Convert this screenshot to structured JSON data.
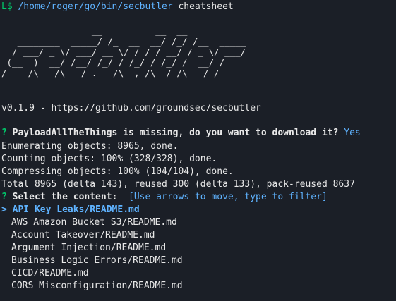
{
  "prompt": {
    "bracket": "L$",
    "path": "/home/roger/go/bin/secbutler",
    "command": "cheatsheet"
  },
  "banner": {
    "art": "                 __          __  __\n   ________  _____/ /_  __  __/ /_/ /__  _____\n  / ___/ _ \\/ ___/ __ \\/ / / / __/ / _ \\/ ___/\n (__  )  __/ /__/ /_/ / /_/ / /_/ /  __/ /\n/____/\\___/\\___/_.___/\\__,_/\\__/_/\\___/_/"
  },
  "version_line": "v0.1.9 - https://github.com/groundsec/secbutler",
  "question": {
    "mark": "?",
    "text": "PayloadAllTheThings is missing, do you want to download it?",
    "answer": "Yes"
  },
  "git_output": [
    "Enumerating objects: 8965, done.",
    "Counting objects: 100% (328/328), done.",
    "Compressing objects: 100% (104/104), done.",
    "Total 8965 (delta 143), reused 300 (delta 133), pack-reused 8637"
  ],
  "select": {
    "mark": "?",
    "label": "Select the content:",
    "hint": "[Use arrows to move, type to filter]",
    "cursor": ">",
    "options": [
      "API Key Leaks/README.md",
      "AWS Amazon Bucket S3/README.md",
      "Account Takeover/README.md",
      "Argument Injection/README.md",
      "Business Logic Errors/README.md",
      "CICD/README.md",
      "CORS Misconfiguration/README.md"
    ],
    "selected_index": 0
  },
  "colors": {
    "background": "#1b1f27",
    "prompt_green": "#00c96b",
    "accent_blue": "#5fb3ff",
    "text": "#e8e8e8"
  }
}
